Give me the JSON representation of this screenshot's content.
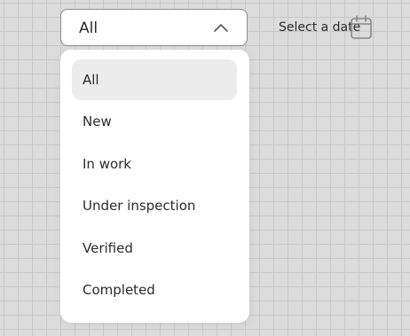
{
  "filter": {
    "selected_value": "All",
    "options": [
      {
        "label": "All",
        "selected": true
      },
      {
        "label": "New",
        "selected": false
      },
      {
        "label": "In work",
        "selected": false
      },
      {
        "label": "Under inspection",
        "selected": false
      },
      {
        "label": "Verified",
        "selected": false
      },
      {
        "label": "Completed",
        "selected": false
      }
    ]
  },
  "date_picker": {
    "placeholder": "Select a date",
    "icon": "calendar-icon"
  },
  "icons": {
    "dropdown_toggle": "chevron-up-icon"
  },
  "colors": {
    "canvas": "#dcdcdc",
    "grid_line": "#c9c9c9",
    "surface": "#ffffff",
    "selected_option_bg": "#ececec",
    "text": "#2b2b2b",
    "border": "#8b8b8b"
  }
}
